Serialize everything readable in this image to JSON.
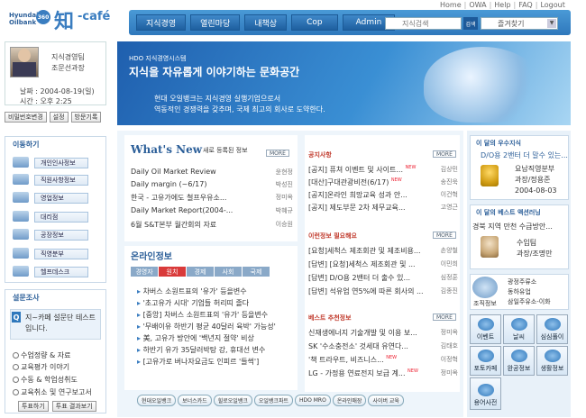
{
  "top_links": [
    "Home",
    "OWA",
    "Help",
    "FAQ",
    "Logout"
  ],
  "logo": {
    "bank_line1": "Hyundai",
    "bank_line2": "Oilbank",
    "circle": "360",
    "knowledge": "知",
    "cafe": "-café"
  },
  "nav": {
    "items": [
      "지식경영",
      "열린마당",
      "내책상",
      "Cop",
      "Admin"
    ]
  },
  "search": {
    "placeholder": "지식검색",
    "button": "검색",
    "favorites": "즐겨찾기"
  },
  "profile": {
    "line1": "지식경영팀",
    "line2": "조문선과장",
    "date": "날짜 : 2004-08-19(일)",
    "time": "시간 : 오후 2:25"
  },
  "profile_buttons": [
    "비밀번호변경",
    "설정",
    "방문기록"
  ],
  "menu": {
    "title": "이동하기",
    "items": [
      "개인인사정보",
      "직원사항정보",
      "영업정보",
      "대리점",
      "공장정보",
      "직영분부",
      "헬프데스크"
    ]
  },
  "poll": {
    "title": "설문조사",
    "question": "지~카페 설문단 테스트 입니다.",
    "options": [
      "수업정량 & 자료",
      "교육평가 이야기",
      "수동 & 학업성취도",
      "교육취소 및 연구보고서"
    ],
    "buttons": [
      "투표하기",
      "투표 결과보기"
    ]
  },
  "banner": {
    "sub": "HDO 지식경영시스템",
    "title": "지식을 자유롭게 이야기하는 문화공간",
    "line1": "현대 오일뱅크는 지식경영 실행기업으로서",
    "line2": "역동적인 경쟁력을 갖추며, 국제 최고의 회사로 도약한다."
  },
  "whats_new": {
    "title": "What's New",
    "subtitle": "새로 등록된 정보",
    "more": "MORE",
    "items": [
      {
        "title": "Daily Oil Market Review",
        "author": "윤현정"
      },
      {
        "title": "Daily margin (~6/17)",
        "author": "박성진"
      },
      {
        "title": "한국 - 고유가에도 철프우유소...",
        "author": "정미옥"
      },
      {
        "title": "Daily Market Report(2004-...",
        "author": "박혜규"
      },
      {
        "title": "6월 S&T본부 월간회의 자료",
        "author": "이승원"
      }
    ]
  },
  "online": {
    "title": "온라인정보",
    "tabs": [
      "경영자",
      "원치",
      "경제",
      "사회",
      "국제"
    ],
    "active_tab": 1,
    "items": [
      "차버스 소원트표의 '유가' 등을변수",
      "'초고유가 시대' 기업들 허리띠 졸다",
      "[중앙] 차버스 소원트표의 '유가' 등을변수",
      "'무배이유 하반기 평균 40달러 육박' 가능성'",
      "美, 고유가 방안에 '백년지 절약' 비상",
      "하반기 유가 35달러박탕 강, 휴대선 변수",
      "[고유가로 버나자요금도 인피르 '들썩']"
    ]
  },
  "notices": {
    "title": "공지사항",
    "more": "MORE",
    "items": [
      {
        "title": "[공지] 퓨쳐 이벤트 및 사이트...",
        "author": "김상민",
        "new": true
      },
      {
        "title": "[대산]구대관광비전(6/17)",
        "author": "송진욱",
        "new": true
      },
      {
        "title": "[공지]온라인 희망교육 성과 안...",
        "author": "이건혁",
        "new": false
      },
      {
        "title": "[공지] 제도부문 2차 제무교육...",
        "author": "고영근",
        "new": false
      }
    ]
  },
  "needed": {
    "title": "이런정보 필요해요",
    "more": "MORE",
    "items": [
      {
        "title": "[요청]세척스 제조회관 및 제조비용...",
        "author": "손양철"
      },
      {
        "title": "[답변] [요청]세척스 제조회관 및 ...",
        "author": "이민희"
      },
      {
        "title": "[답변] D/O용 2밴터 더 출수 있...",
        "author": "심정훈"
      },
      {
        "title": "[답변] 석유업 연5%에 따른 회사의 ...",
        "author": "김종진"
      }
    ]
  },
  "best": {
    "title": "베스트 추천정보",
    "more": "MORE",
    "items": [
      {
        "title": "신재생에너지 기술개발 및 이용 보...",
        "author": "정미옥",
        "new": false
      },
      {
        "title": "SK '수소충전소' 것세대 유연다...",
        "author": "김태호",
        "new": false
      },
      {
        "title": "'책 트라우트, 비즈니스...",
        "author": "이정혁",
        "new": true
      },
      {
        "title": "LG - 가정용 연료전지 보급 계...",
        "author": "정미옥",
        "new": true
      }
    ]
  },
  "bottom_links": [
    "현대오일뱅크",
    "보너스카드",
    "힐로오일뱅크",
    "오일뱅크파트",
    "HDO MRO",
    "온라인매장",
    "사이버 교육"
  ],
  "expert": {
    "title": "이 달의 우수지식",
    "text": "D/O용 2밴터 더 말수 있는...",
    "name1": "요남직영분부",
    "name2": "과장/정용준",
    "date": "2004-08-03"
  },
  "best_action": {
    "title": "이 달의 베스트 액션러닝",
    "text": "경북 지역 만천 수급방안...",
    "name1": "수입팀",
    "name2": "과장/조명만"
  },
  "quick": {
    "label": "조직정보",
    "lines": [
      "광정주류소",
      "동하유업",
      "삼일주유소-이화"
    ]
  },
  "grid_buttons": [
    "이벤트",
    "날씨",
    "심심풀이",
    "포토카페",
    "완공정보",
    "생활정보",
    "용어사전"
  ]
}
